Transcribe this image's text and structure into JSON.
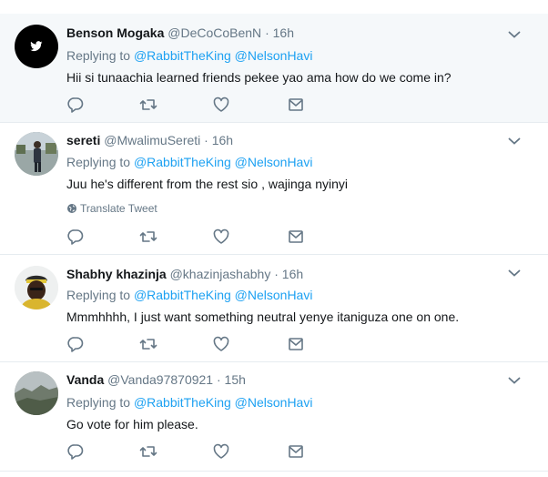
{
  "tweets": [
    {
      "name": "Benson Mogaka",
      "handle": "@DeCoCoBenN",
      "dot": "·",
      "time": "16h",
      "reply_prefix": "Replying to",
      "mentions": [
        "@RabbitTheKing",
        "@NelsonHavi"
      ],
      "text": "Hii si tunaachia learned friends pekee yao ama how do we come in?",
      "translate": "",
      "avatar_icon": "twitter-bird-icon"
    },
    {
      "name": "sereti",
      "handle": "@MwalimuSereti",
      "dot": "·",
      "time": "16h",
      "reply_prefix": "Replying to",
      "mentions": [
        "@RabbitTheKing",
        "@NelsonHavi"
      ],
      "text": "Juu he's different from the rest sio , wajinga nyinyi",
      "translate": "Translate Tweet",
      "avatar_icon": "person-photo"
    },
    {
      "name": "Shabhy khazinja",
      "handle": "@khazinjashabhy",
      "dot": "·",
      "time": "16h",
      "reply_prefix": "Replying to",
      "mentions": [
        "@RabbitTheKing",
        "@NelsonHavi"
      ],
      "text": "Mmmhhhh, I just want something neutral yenye itaniguza one on one.",
      "translate": "",
      "avatar_icon": "person-photo"
    },
    {
      "name": "Vanda",
      "handle": "@Vanda97870921",
      "dot": "·",
      "time": "15h",
      "reply_prefix": "Replying to",
      "mentions": [
        "@RabbitTheKing",
        "@NelsonHavi"
      ],
      "text": "Go vote for him please.",
      "translate": "",
      "avatar_icon": "landscape-photo"
    }
  ],
  "icons": {
    "reply": "reply-icon",
    "retweet": "retweet-icon",
    "like": "heart-icon",
    "dm": "envelope-icon",
    "caret": "chevron-down-icon",
    "globe": "globe-icon"
  },
  "colors": {
    "link": "#1da1f2",
    "secondary": "#657786",
    "highlight_bg": "#f5f8fa",
    "border": "#e6ecf0"
  }
}
